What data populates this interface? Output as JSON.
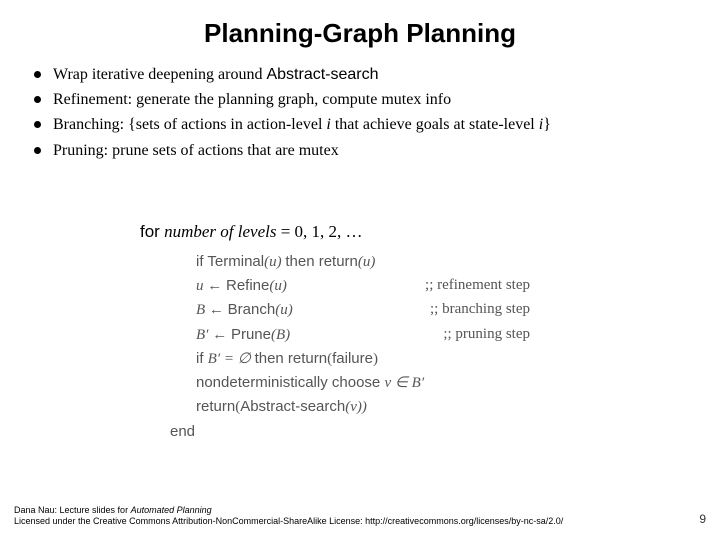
{
  "title": "Planning-Graph Planning",
  "bullets": {
    "b1_a": "Wrap iterative deepening around ",
    "b1_b": "Abstract-search",
    "b2": "Refinement: generate the planning graph, compute mutex info",
    "b3_a": "Branching: {sets of actions in action-level ",
    "b3_i1": "i",
    "b3_b": " that achieve goals at state-level ",
    "b3_i2": "i",
    "b3_c": "}",
    "b4": "Pruning: prune sets of actions that are mutex"
  },
  "forline": {
    "kw": "for",
    "expr": " number of levels ",
    "tail": " = 0, 1, 2, …"
  },
  "pseudo": {
    "l1_a": "if ",
    "l1_b": "Terminal",
    "l1_c": "(u) ",
    "l1_d": "then return",
    "l1_e": "(u)",
    "l2_a": "u ← ",
    "l2_b": "Refine",
    "l2_c": "(u)",
    "l2_cmt": ";;   refinement step",
    "l3_a": "B ← ",
    "l3_b": "Branch",
    "l3_c": "(u)",
    "l3_cmt": ";;   branching step",
    "l4_a": "B′ ← ",
    "l4_b": "Prune",
    "l4_c": "(B)",
    "l4_cmt": ";;   pruning step",
    "l5_a": "if ",
    "l5_b": "B′ = ∅ ",
    "l5_c": "then return",
    "l5_d": "(",
    "l5_e": "failure",
    "l5_f": ")",
    "l6": "nondeterministically choose ",
    "l6_b": "v ∈ B′",
    "l7_a": "return",
    "l7_b": "(",
    "l7_c": "Abstract-search",
    "l7_d": "(v))",
    "l8": "end"
  },
  "footer": {
    "line1_a": "Dana Nau: Lecture slides for ",
    "line1_b": "Automated Planning",
    "line2": "Licensed under the Creative Commons Attribution-NonCommercial-ShareAlike License: http://creativecommons.org/licenses/by-nc-sa/2.0/",
    "page": "9"
  }
}
